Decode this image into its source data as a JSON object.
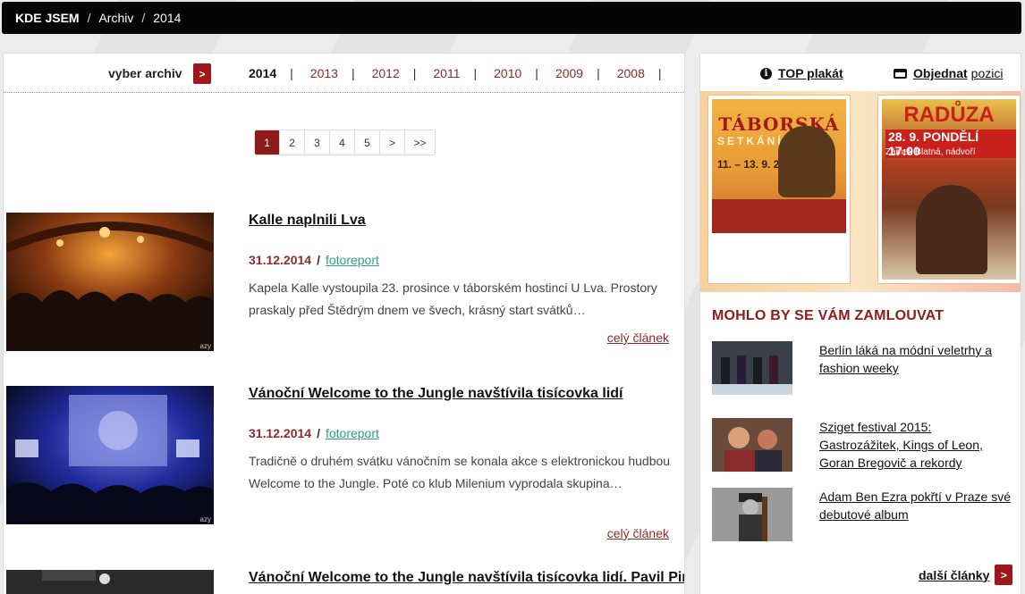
{
  "breadcrumb": {
    "label": "KDE JSEM",
    "items": [
      "Archiv",
      "2014"
    ],
    "separator": "/"
  },
  "archive": {
    "label": "vyber archiv",
    "button": ">",
    "years": [
      "2014",
      "2013",
      "2012",
      "2011",
      "2010",
      "2009",
      "2008"
    ],
    "current_year": "2014",
    "separator": "|"
  },
  "pagination": [
    "1",
    "2",
    "3",
    "4",
    "5",
    ">",
    ">>"
  ],
  "articles": [
    {
      "title": "Kalle naplnili Lva",
      "date": "31.12.2014",
      "category": "fotoreport",
      "text": "Kapela Kalle vystoupila 23. prosince v táborském hostinci U Lva. Prostory praskaly před Štědrým dnem ve švech, krásný start svátků…",
      "more": "celý článek",
      "credit": "azy"
    },
    {
      "title": "Vánoční Welcome to the Jungle navštívila tisícovka lidí",
      "date": "31.12.2014",
      "category": "fotoreport",
      "text": "Tradičně o druhém svátku vánočním se konala akce s elektronickou hudbou Welcome to the Jungle. Poté co klub Milenium vyprodala skupina…",
      "more": "celý článek",
      "credit": "azy"
    },
    {
      "title": "Vánoční Welcome to the Jungle navštívila tisícovka lidí. Pavil Pirini Forbidden Society"
    }
  ],
  "sidebar": {
    "top_poster": "TOP plakát",
    "order_bold": "Objednat",
    "order_light": "pozici",
    "posters": [
      {
        "title": "TÁBORSKÁ",
        "subtitle": "SETKÁNÍ",
        "dates": "11. – 13. 9. 2015"
      },
      {
        "title": "RADŮZA",
        "date": "28. 9. PONDĚLÍ 17:00",
        "place": "Zámek Blatná, nádvoří"
      }
    ],
    "heading": "MOHLO BY SE VÁM ZAMLOUVAT",
    "recommended": [
      "Berlín láká na módní veletrhy a fashion weeky",
      "Sziget festival 2015: Gastrozážitek, Kings of Leon, Goran Bregovič a rekordy",
      "Adam Ben Ezra pokřtí v Praze své debutové album"
    ],
    "more_label": "další články",
    "more_button": ">"
  },
  "colors": {
    "accent_red": "#8e1a1a",
    "category_green": "#2aa084",
    "topbar_black": "#050505"
  }
}
